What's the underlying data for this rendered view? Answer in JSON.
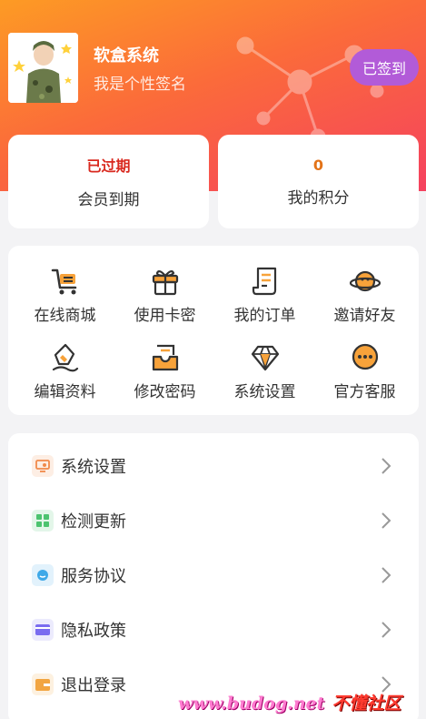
{
  "profile": {
    "name": "软盒系统",
    "signature": "我是个性签名",
    "checkin_label": "已签到"
  },
  "stats": [
    {
      "value": "已过期",
      "label": "会员到期",
      "color": "#d9291f"
    },
    {
      "value": "0",
      "label": "我的积分",
      "color": "#e37318"
    }
  ],
  "grid": [
    {
      "label": "在线商城",
      "icon": "shopping-cart-icon"
    },
    {
      "label": "使用卡密",
      "icon": "gift-icon"
    },
    {
      "label": "我的订单",
      "icon": "order-scroll-icon"
    },
    {
      "label": "邀请好友",
      "icon": "planet-icon"
    },
    {
      "label": "编辑资料",
      "icon": "pen-nib-icon"
    },
    {
      "label": "修改密码",
      "icon": "inbox-tray-icon"
    },
    {
      "label": "系统设置",
      "icon": "diamond-icon"
    },
    {
      "label": "官方客服",
      "icon": "chat-bubble-icon"
    }
  ],
  "menu": [
    {
      "label": "系统设置",
      "icon": "monitor-icon",
      "color": "#f08a4b"
    },
    {
      "label": "检测更新",
      "icon": "grid-squares-icon",
      "color": "#4cc36f"
    },
    {
      "label": "服务协议",
      "icon": "message-icon",
      "color": "#3fa9e8"
    },
    {
      "label": "隐私政策",
      "icon": "card-icon",
      "color": "#7a6cf0"
    },
    {
      "label": "退出登录",
      "icon": "wallet-icon",
      "color": "#f2a541"
    }
  ],
  "watermark": {
    "url": "www.budog.net",
    "name": "不懂社区"
  },
  "colors": {
    "accent": "#fb6b3a",
    "icon_orange": "#f7a23a",
    "checkin": "#b25bd8"
  }
}
